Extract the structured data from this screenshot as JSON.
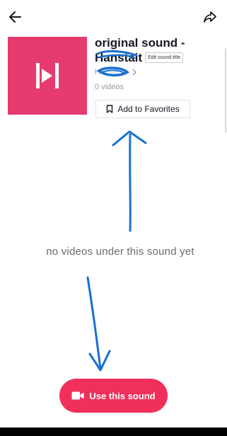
{
  "header": {
    "back_icon": "arrow-left-icon",
    "share_icon": "share-arrow-icon"
  },
  "sound": {
    "title_line1": "original sound -",
    "username": "Hanstait",
    "edit_title_label": "Edit sound title",
    "author": "H",
    "videos_count": "0 videos",
    "cover_color": "#e63b6f",
    "cover_icon": "music-play-icon"
  },
  "favorites": {
    "label": "Add to Favorites",
    "icon": "bookmark-icon"
  },
  "empty_state": {
    "message": "no videos under this sound yet"
  },
  "use_button": {
    "label": "Use this sound",
    "icon": "video-camera-icon",
    "color": "#f0305b"
  },
  "annotation": {
    "color": "#1a6fd1"
  }
}
